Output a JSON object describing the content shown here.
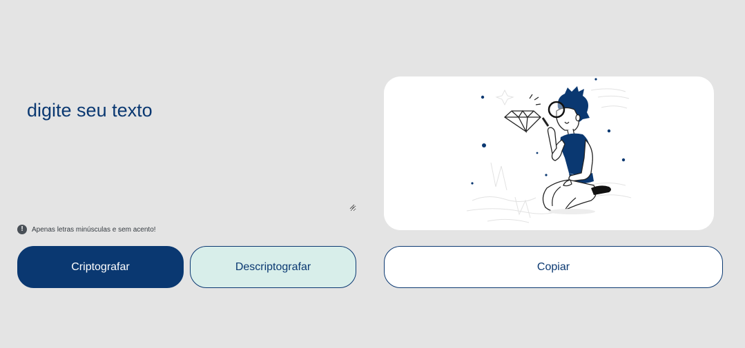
{
  "input": {
    "placeholder": "digite seu texto"
  },
  "hint": {
    "icon": "exclamation-circle-icon",
    "text": "Apenas letras minúsculas e sem acento!"
  },
  "buttons": {
    "encrypt_label": "Criptografar",
    "decrypt_label": "Descriptografar",
    "copy_label": "Copiar"
  },
  "output": {
    "illustration": "person-with-magnifying-glass-illustration"
  },
  "colors": {
    "background": "#e4e4e4",
    "primary": "#0a3871",
    "secondary_button": "#d8eeea",
    "panel": "#ffffff"
  }
}
